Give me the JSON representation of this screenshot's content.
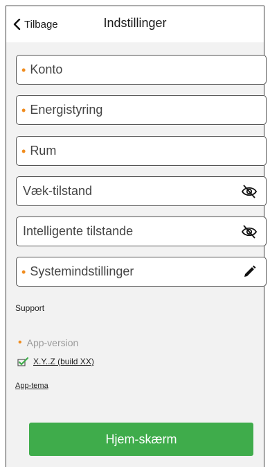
{
  "header": {
    "back_label": "Tilbage",
    "title": "Indstillinger"
  },
  "menu": [
    {
      "label": "Konto",
      "bullet": true,
      "trail_icon": null
    },
    {
      "label": "Energistyring",
      "bullet": true,
      "trail_icon": null
    },
    {
      "label": "Rum",
      "bullet": true,
      "trail_icon": null
    },
    {
      "label": "Væk-tilstand",
      "bullet": false,
      "trail_icon": "eye-slash-icon"
    },
    {
      "label": "Intelligente tilstande",
      "bullet": false,
      "trail_icon": "eye-slash-icon"
    },
    {
      "label": "Systemindstillinger",
      "bullet": true,
      "trail_icon": "pencil-icon"
    }
  ],
  "support_label": "Support",
  "app_version": {
    "label": "App-version",
    "build": "X.Y..Z (build XX)"
  },
  "app_theme_label": "App-tema",
  "home_button_label": "Hjem-skærm",
  "colors": {
    "accent_bullet": "#f08c1e",
    "primary_button": "#3fac4b",
    "background": "#f2f2f2"
  }
}
